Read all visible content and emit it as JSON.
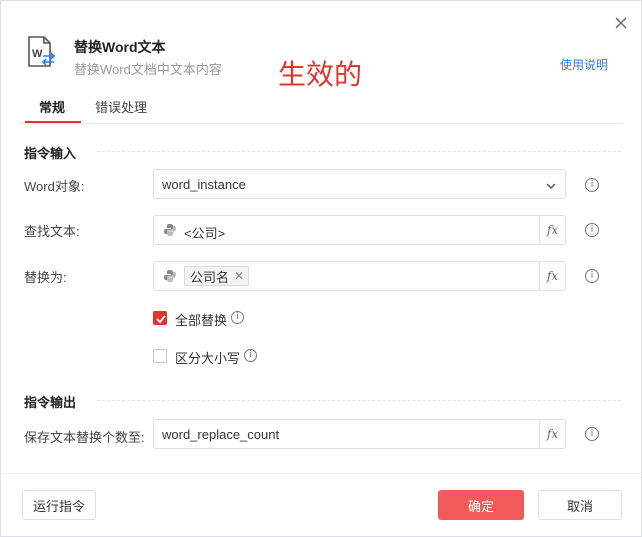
{
  "header": {
    "title": "替换Word文本",
    "subtitle": "替换Word文档中文本内容",
    "status_text": "生效的",
    "help_link": "使用说明",
    "app_icon": "word-replace-icon"
  },
  "tabs": [
    {
      "label": "常规",
      "active": true
    },
    {
      "label": "错误处理",
      "active": false
    }
  ],
  "input_section": {
    "title": "指令输入",
    "fields": {
      "word_object": {
        "label": "Word对象:",
        "value": "word_instance"
      },
      "find_text": {
        "label": "查找文本:",
        "value": "<公司>"
      },
      "replace_with": {
        "label": "替换为:",
        "tag": "公司名"
      }
    },
    "options": {
      "replace_all": {
        "label": "全部替换",
        "checked": true
      },
      "case_sensitive": {
        "label": "区分大小写",
        "checked": false
      }
    }
  },
  "output_section": {
    "title": "指令输出",
    "fields": {
      "save_count": {
        "label": "保存文本替换个数至:",
        "value": "word_replace_count"
      }
    }
  },
  "fx_label": "fx",
  "footer": {
    "run_label": "运行指令",
    "ok_label": "确定",
    "cancel_label": "取消"
  },
  "colors": {
    "accent": "#e2332f",
    "primary_button": "#f15a5a",
    "link": "#2d7ee8"
  }
}
